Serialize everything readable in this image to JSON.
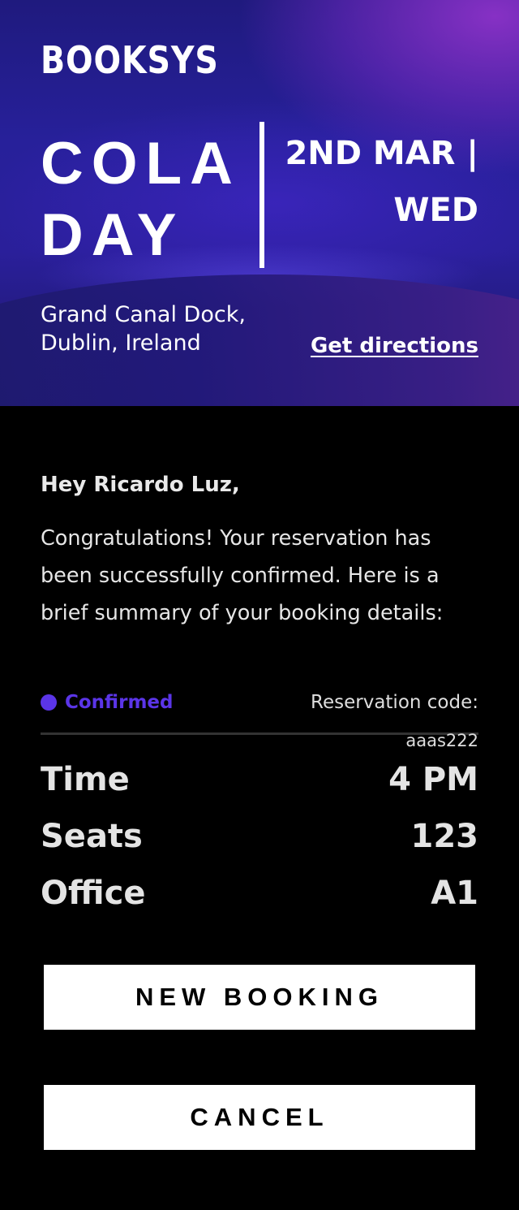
{
  "brand": {
    "name": "BOOKSYS"
  },
  "event": {
    "name": "COLA DAY",
    "date": "2ND MAR | WED",
    "address": "Grand Canal Dock, Dublin, Ireland",
    "directions_label": "Get directions"
  },
  "message": {
    "greeting": "Hey Ricardo Luz,",
    "body": "Congratulations! Your reservation has been successfully confirmed. Here is a brief summary of your booking details:"
  },
  "reservation": {
    "status": "Confirmed",
    "code_label": "Reservation code:",
    "code": "aaas222"
  },
  "details": [
    {
      "label": "Time",
      "value": "4 PM"
    },
    {
      "label": "Seats",
      "value": "123"
    },
    {
      "label": "Office",
      "value": "A1"
    }
  ],
  "actions": {
    "new_booking_label": "NEW BOOKING",
    "cancel_label": "CANCEL"
  },
  "colors": {
    "status_accent": "#5b35e8",
    "hero_gradient_start": "#1f1a7e",
    "hero_gradient_end": "#8a32c8",
    "background": "#000000",
    "button_bg": "#ffffff"
  }
}
